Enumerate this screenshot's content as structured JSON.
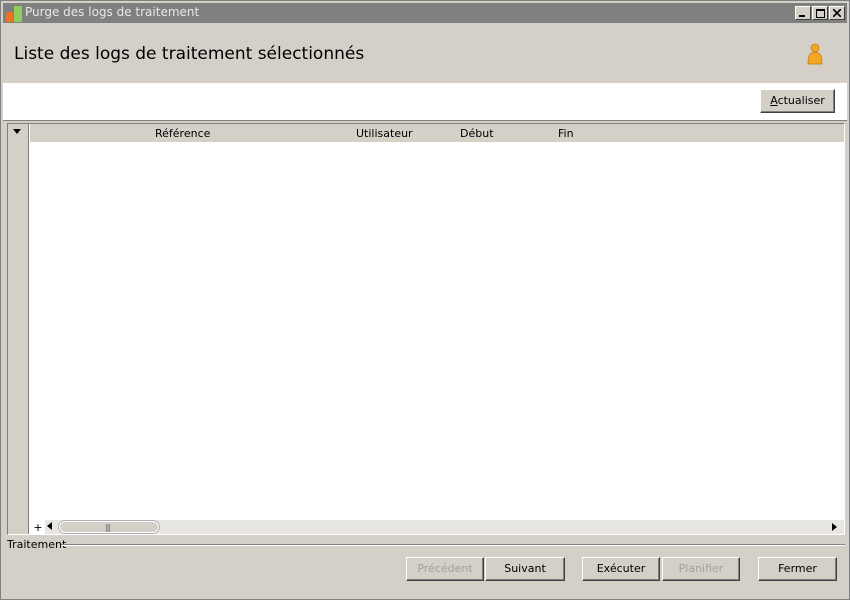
{
  "window": {
    "title": "Purge des logs de traitement"
  },
  "header": {
    "title": "Liste des logs de traitement sélectionnés"
  },
  "toolbar": {
    "refresh_label_accel": "A",
    "refresh_label_rest": "ctualiser"
  },
  "grid": {
    "columns": [
      "Référence",
      "Utilisateur",
      "Début",
      "Fin"
    ],
    "rows": [],
    "add_symbol": "+",
    "scroll_grip": "|||"
  },
  "group": {
    "label": "Traitement"
  },
  "footer": {
    "prev_label": "Précédent",
    "next_label": "Suivant",
    "execute_label": "Exécuter",
    "plan_label": "Planifier",
    "close_label": "Fermer"
  },
  "icons": {
    "app": "app-logo-icon",
    "user": "user-icon",
    "minimize": "minimize-icon",
    "maximize": "maximize-icon",
    "close": "close-icon",
    "grid_menu": "dropdown-arrow-icon",
    "scroll_left": "scroll-left-arrow-icon",
    "scroll_right": "scroll-right-arrow-icon"
  },
  "colors": {
    "titlebar": "#808080",
    "user_icon": "#f5a623",
    "app_icon_orange": "#e8742a",
    "app_icon_green": "#8fce5a"
  }
}
